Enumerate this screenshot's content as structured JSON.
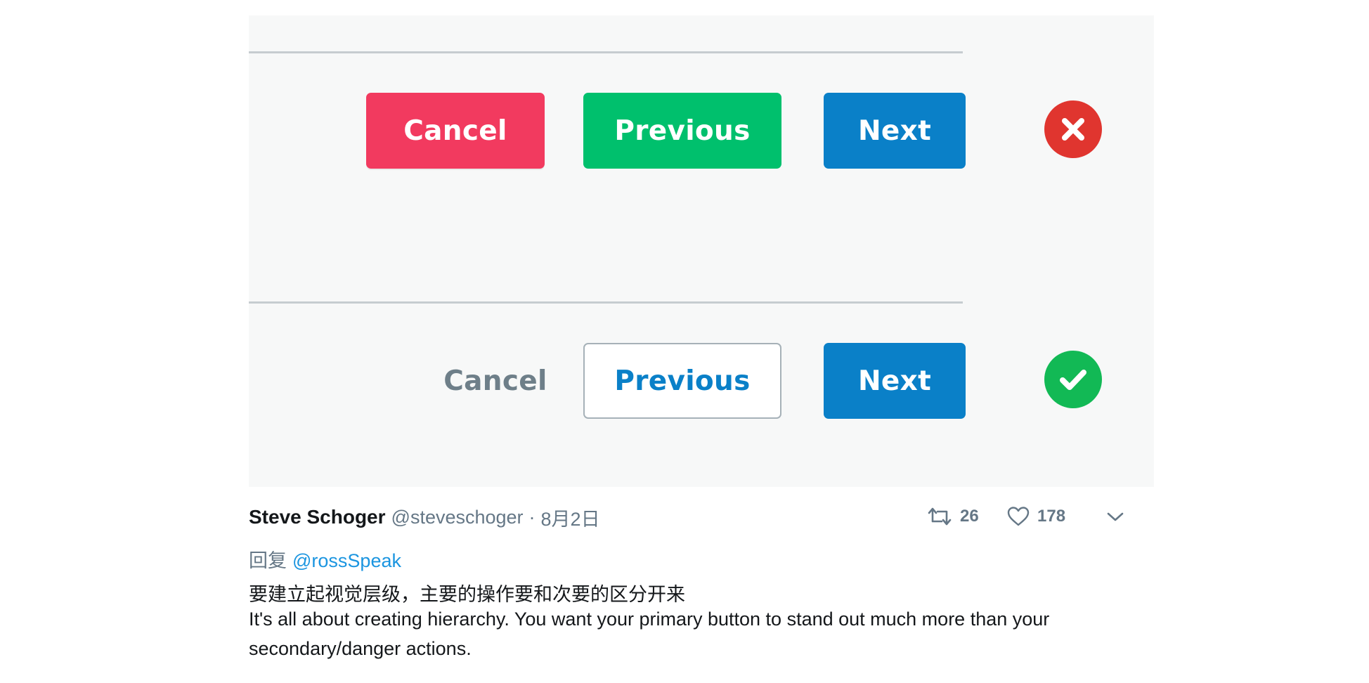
{
  "example_top": {
    "cancel_label": "Cancel",
    "previous_label": "Previous",
    "next_label": "Next",
    "status": "incorrect",
    "colors": {
      "cancel": "#f23a5f",
      "previous": "#00c06d",
      "next": "#0a80c8",
      "status": "#e0352f"
    }
  },
  "example_bottom": {
    "cancel_label": "Cancel",
    "previous_label": "Previous",
    "next_label": "Next",
    "status": "correct",
    "colors": {
      "cancel_text": "#6e7f89",
      "previous_border": "#a6b1b8",
      "next": "#0a80c8",
      "status": "#12b955"
    }
  },
  "tweet": {
    "author_name": "Steve Schoger",
    "author_handle": "@steveschoger",
    "separator": "·",
    "date": "8月2日",
    "retweet_count": "26",
    "like_count": "178",
    "reply_prefix": "回复",
    "reply_to": "@rossSpeak",
    "text_cn": "要建立起视觉层级，主要的操作要和次要的区分开来",
    "text_en_line1": "It's all about creating hierarchy. You want your primary button to stand out much more than your",
    "text_en_line2": "secondary/danger actions.",
    "icons": [
      "retweet-icon",
      "heart-icon",
      "chevron-down-icon"
    ],
    "colors": {
      "link": "#1b95e0",
      "muted": "#657786",
      "text": "#14171a"
    }
  }
}
